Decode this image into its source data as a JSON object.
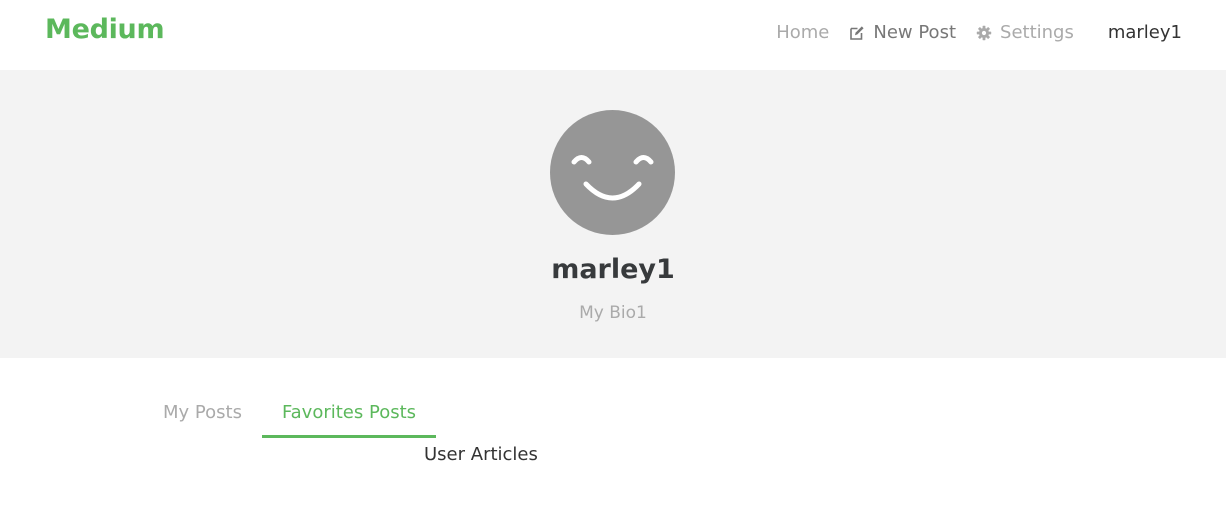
{
  "brand": {
    "name": "Medium",
    "color": "#5cb85c"
  },
  "nav": {
    "home_label": "Home",
    "new_post_label": "New Post",
    "new_post_icon": "edit-icon",
    "settings_label": "Settings",
    "settings_icon": "gear-icon",
    "user_label": "marley1"
  },
  "profile": {
    "avatar_icon": "smiley-avatar-icon",
    "username": "marley1",
    "bio": "My Bio1"
  },
  "tabs": [
    {
      "label": "My Posts",
      "active": false
    },
    {
      "label": "Favorites Posts",
      "active": true
    }
  ],
  "content": {
    "label": "User Articles"
  },
  "colors": {
    "accent": "#5cb85c",
    "banner_bg": "#f3f3f3",
    "avatar_bg": "#969696"
  }
}
